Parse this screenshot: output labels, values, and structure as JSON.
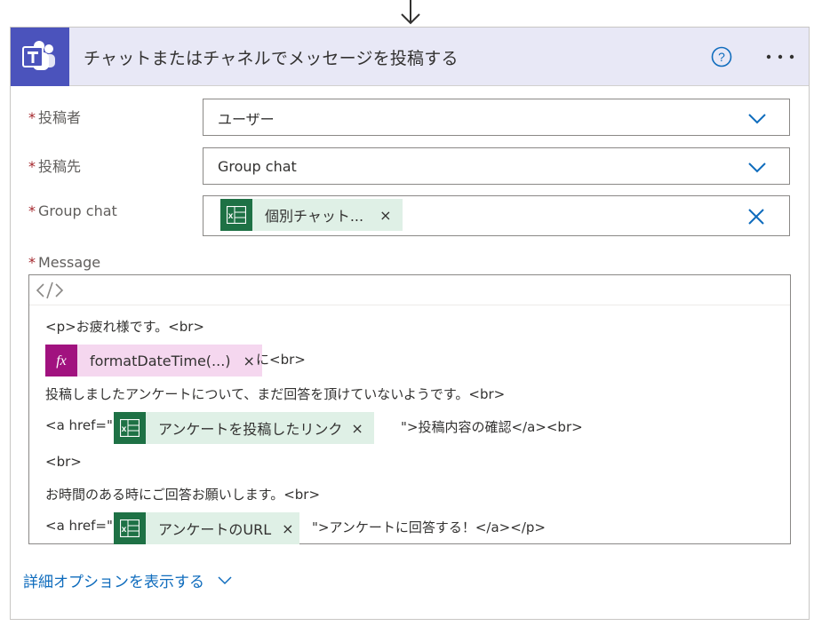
{
  "action": {
    "title": "チャットまたはチャネルでメッセージを投稿する",
    "colors": {
      "teams": "#4b53bc",
      "excel": "#1e7145",
      "expression": "#a1127f",
      "link": "#0f6cbd",
      "required": "#a4262c"
    }
  },
  "fields": {
    "post_as": {
      "label": "投稿者",
      "value": "ユーザー",
      "icon": "chevron-down-icon"
    },
    "post_in": {
      "label": "投稿先",
      "value": "Group chat",
      "icon": "chevron-down-icon"
    },
    "group_chat": {
      "label": "Group chat",
      "token": "個別チャット...",
      "icon": "clear-icon"
    },
    "message": {
      "label": "Message",
      "line1": "<p>お疲れ様です。<br>",
      "token_fx": "formatDateTime(...)",
      "line2_suffix": "に<br>",
      "line3": "投稿しましたアンケートについて、まだ回答を頂けていないようです。<br>",
      "line4_prefix": "<a href=\"",
      "token_link": "アンケートを投稿したリンク",
      "line4_suffix": "\">投稿内容の確認</a><br>",
      "line5": "<br>",
      "line6": "お時間のある時にご回答お願いします。<br>",
      "line7_prefix": "<a href=\"",
      "token_url": "アンケートのURL",
      "line7_suffix": "\">アンケートに回答する！</a></p>"
    }
  },
  "token_remove": "×",
  "required_mark": "*",
  "advanced_options": "詳細オプションを表示する"
}
